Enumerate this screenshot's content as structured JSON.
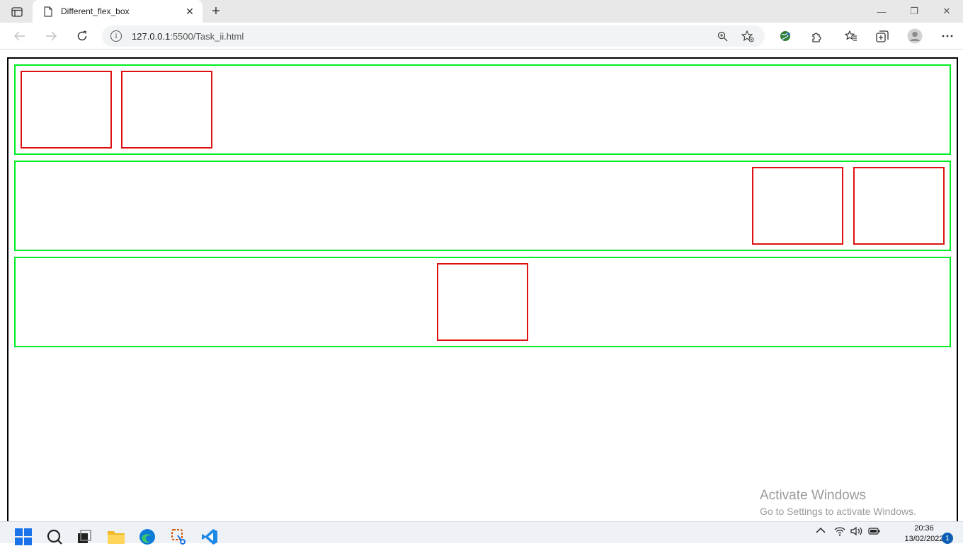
{
  "browser": {
    "tab": {
      "title": "Different_flex_box",
      "close_glyph": "✕"
    },
    "new_tab_glyph": "+",
    "window_controls": {
      "minimize": "—",
      "maximize": "❐",
      "close": "✕"
    },
    "address": {
      "host": "127.0.0.1",
      "rest": ":5500/Task_ii.html"
    }
  },
  "page": {
    "rows": [
      {
        "justify": "flex-start",
        "box_count": 2
      },
      {
        "justify": "flex-end",
        "box_count": 2
      },
      {
        "justify": "center",
        "box_count": 1
      }
    ],
    "colors": {
      "outer_border": "#000000",
      "row_border": "#00ee22",
      "box_border": "#dd1111"
    }
  },
  "watermark": {
    "title": "Activate Windows",
    "subtitle": "Go to Settings to activate Windows."
  },
  "taskbar": {
    "time": "20:36",
    "date": "13/02/2022",
    "notification_count": "1",
    "icons": [
      "start-icon",
      "search-icon",
      "task-view-icon",
      "file-explorer-icon",
      "edge-icon",
      "snipping-tool-icon",
      "vscode-icon"
    ]
  }
}
